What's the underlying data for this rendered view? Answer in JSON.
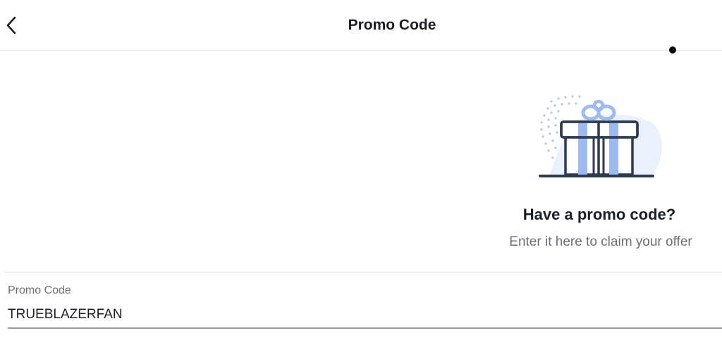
{
  "header": {
    "title": "Promo Code",
    "back_icon": "chevron-left-icon"
  },
  "illustration": {
    "icon": "gift-box-icon",
    "colors": {
      "outline": "#2c3a52",
      "ribbon": "#9dbbf0",
      "blob": "#eaf1fc",
      "dots": "#b7c6dc"
    }
  },
  "promo": {
    "heading": "Have a promo code?",
    "subtext": "Enter it here to claim your offer"
  },
  "form": {
    "label": "Promo Code",
    "value": "TRUEBLAZERFAN"
  }
}
